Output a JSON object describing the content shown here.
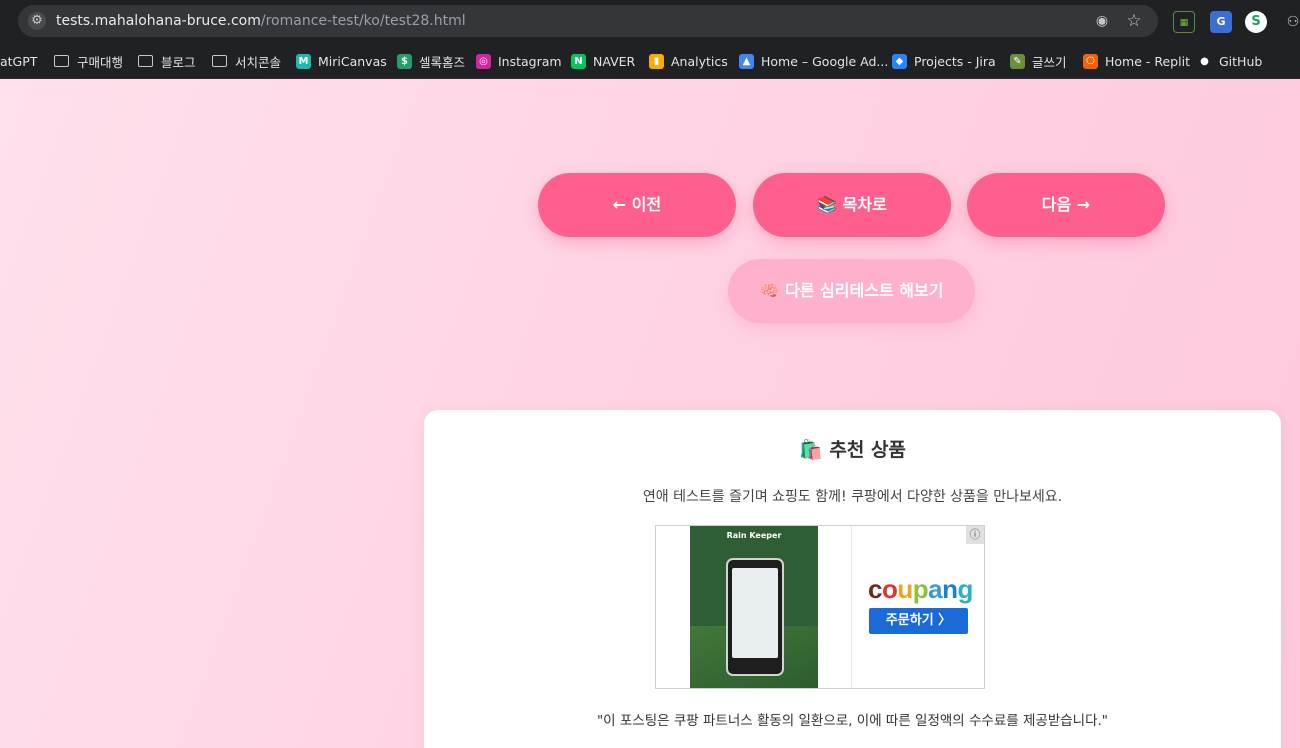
{
  "browser": {
    "url_host": "tests.mahalohana-bruce.com",
    "url_path": "/romance-test/ko/test28.html",
    "icons": {
      "site_info": "tune-icon",
      "eye": "eye-icon",
      "star": "star-icon"
    }
  },
  "bookmarks": [
    {
      "label": "atGPT",
      "icon": "none"
    },
    {
      "label": "구매대행",
      "icon": "folder-icon"
    },
    {
      "label": "블로그",
      "icon": "folder-icon"
    },
    {
      "label": "서치콘솔",
      "icon": "folder-icon"
    },
    {
      "label": "MiriCanvas",
      "icon": "miricanvas-icon"
    },
    {
      "label": "셀록홈즈",
      "icon": "sellock-icon"
    },
    {
      "label": "Instagram",
      "icon": "instagram-icon"
    },
    {
      "label": "NAVER",
      "icon": "naver-icon"
    },
    {
      "label": "Analytics",
      "icon": "analytics-icon"
    },
    {
      "label": "Home – Google Ad...",
      "icon": "google-ads-icon"
    },
    {
      "label": "Projects - Jira",
      "icon": "jira-icon"
    },
    {
      "label": "글쓰기",
      "icon": "writing-icon"
    },
    {
      "label": "Home - Replit",
      "icon": "replit-icon"
    },
    {
      "label": "GitHub",
      "icon": "github-icon"
    }
  ],
  "nav": {
    "prev_label": "← 이전",
    "toc_label": "📚 목차로",
    "next_label": "다음 →",
    "other_tests_label": "🧠 다른 심리테스트 해보기"
  },
  "recommend": {
    "title": "🛍️ 추천 상품",
    "description": "연애 테스트를 즐기며 쇼핑도 함께! 쿠팡에서 다양한 상품을 만나보세요.",
    "ad": {
      "image_title": "Rain Keeper",
      "brand": "coupang",
      "order_label": "주문하기 〉",
      "info_icon": "info-icon"
    },
    "disclaimer": "\"이 포스팅은 쿠팡 파트너스 활동의 일환으로, 이에 따른 일정액의 수수료를 제공받습니다.\""
  },
  "colors": {
    "nav_button": "#ff5f8f",
    "other_button": "#ffb0cc",
    "coupang_blue": "#1a6ad8"
  }
}
